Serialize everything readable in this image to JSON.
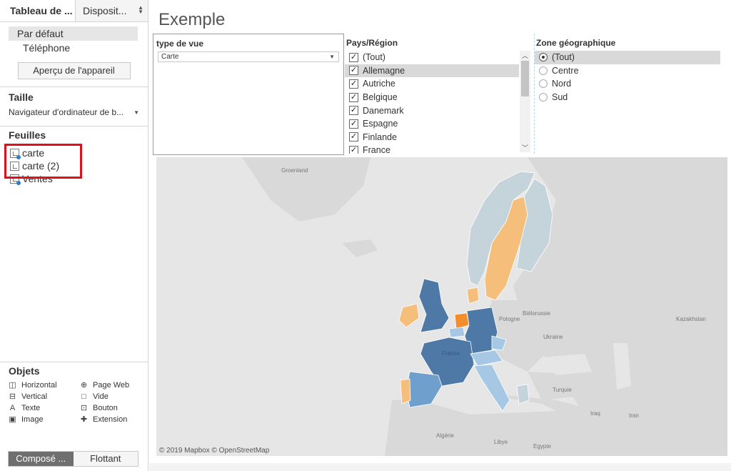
{
  "sidebar": {
    "tabs": [
      {
        "label": "Tableau de ..."
      },
      {
        "label": "Disposit..."
      }
    ],
    "device": {
      "default": "Par défaut",
      "phone": "Téléphone",
      "preview_button": "Aperçu de l'appareil"
    },
    "size": {
      "title": "Taille",
      "value": "Navigateur d'ordinateur de b..."
    },
    "sheets": {
      "title": "Feuilles",
      "items": [
        "carte",
        "carte (2)",
        "Ventes"
      ]
    },
    "objects": {
      "title": "Objets",
      "items": [
        {
          "label": "Horizontal",
          "icon": "horizontal-icon"
        },
        {
          "label": "Page Web",
          "icon": "globe-icon"
        },
        {
          "label": "Vertical",
          "icon": "vertical-icon"
        },
        {
          "label": "Vide",
          "icon": "blank-icon"
        },
        {
          "label": "Texte",
          "icon": "text-icon"
        },
        {
          "label": "Bouton",
          "icon": "button-icon"
        },
        {
          "label": "Image",
          "icon": "image-icon"
        },
        {
          "label": "Extension",
          "icon": "extension-icon"
        }
      ]
    },
    "layout_toggle": {
      "tiled": "Composé ...",
      "floating": "Flottant"
    }
  },
  "dashboard": {
    "title": "Exemple",
    "view_filter": {
      "title": "type de vue",
      "value": "Carte"
    },
    "country_filter": {
      "title": "Pays/Région",
      "items": [
        {
          "label": "(Tout)",
          "checked": true
        },
        {
          "label": "Allemagne",
          "checked": true,
          "selected": true
        },
        {
          "label": "Autriche",
          "checked": true
        },
        {
          "label": "Belgique",
          "checked": true
        },
        {
          "label": "Danemark",
          "checked": true
        },
        {
          "label": "Espagne",
          "checked": true
        },
        {
          "label": "Finlande",
          "checked": true
        },
        {
          "label": "France",
          "checked": true
        }
      ]
    },
    "zone_filter": {
      "title": "Zone géographique",
      "items": [
        {
          "label": "(Tout)",
          "selected": true
        },
        {
          "label": "Centre"
        },
        {
          "label": "Nord"
        },
        {
          "label": "Sud"
        }
      ]
    },
    "map": {
      "labels": {
        "groenland": "Groenland",
        "pologne": "Pologne",
        "bielorussie": "Biélorussie",
        "ukraine": "Ukraine",
        "kazakhstan": "Kazakhstan",
        "turquie": "Turquie",
        "iraq": "Iraq",
        "iran": "Iran",
        "algerie": "Algérie",
        "libye": "Libye",
        "egypte": "Egypte",
        "france": "France"
      },
      "credit": "© 2019 Mapbox © OpenStreetMap",
      "colors": {
        "dark_blue": "#4e79a7",
        "mid_blue": "#6f9fcc",
        "light_blue": "#a6c8e5",
        "grey_blue": "#c5d3da",
        "light_orange": "#f5be7a",
        "orange": "#f28e2b",
        "land": "#d9d9d9",
        "water": "#e6e6e6"
      }
    }
  }
}
